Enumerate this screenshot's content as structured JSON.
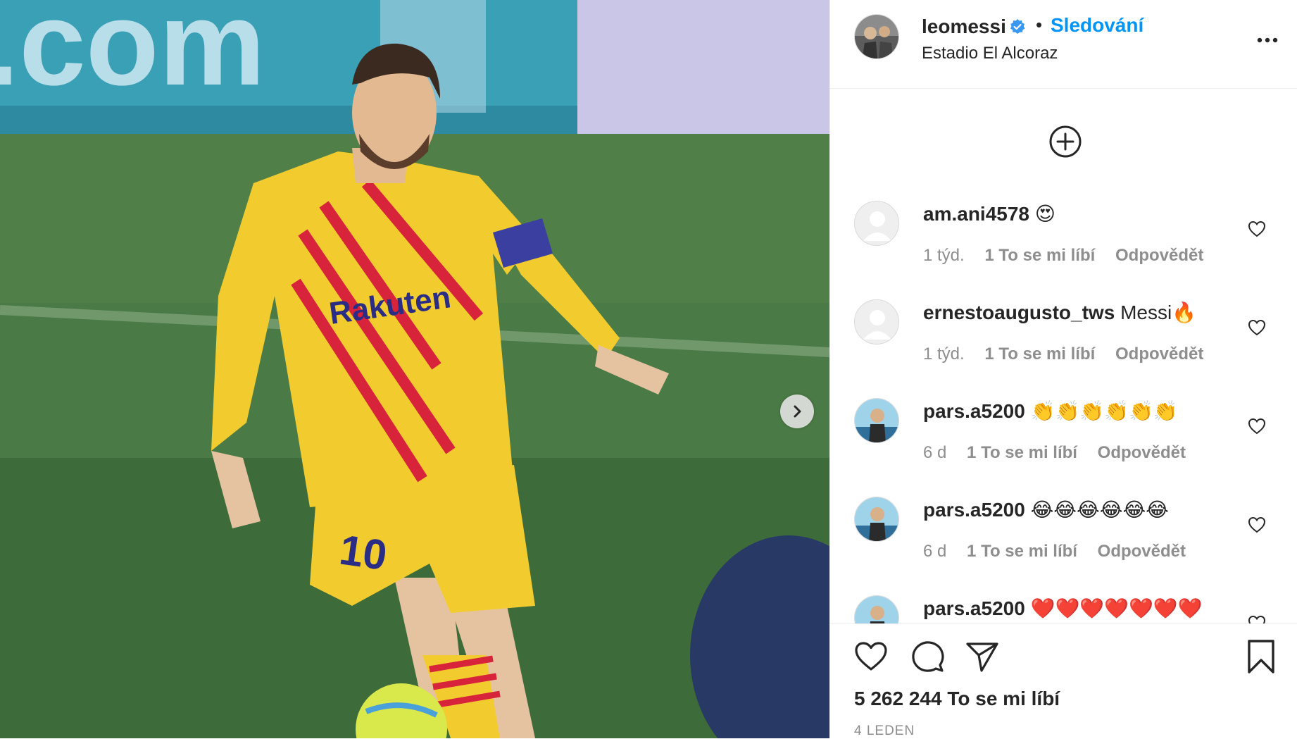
{
  "post": {
    "username": "leomessi",
    "follow_label": "Sledování",
    "dot": "•",
    "location": "Estadio El Alcoraz",
    "more_icon": "more-options-icon"
  },
  "media": {
    "banner_text": ".com",
    "sponsor": "Rakuten",
    "shirt_number": "10",
    "next_icon": "chevron-right-icon"
  },
  "comments": [
    {
      "user": "am.ani4578",
      "text": "😍",
      "time": "1 týd.",
      "likes": "1 To se mi líbí",
      "reply": "Odpovědět",
      "avatar": "default"
    },
    {
      "user": "ernestoaugusto_tws",
      "text": "Messi🔥",
      "time": "1 týd.",
      "likes": "1 To se mi líbí",
      "reply": "Odpovědět",
      "avatar": "default"
    },
    {
      "user": "pars.a5200",
      "text": "👏👏👏👏👏👏",
      "time": "6 d",
      "likes": "1 To se mi líbí",
      "reply": "Odpovědět",
      "avatar": "photo"
    },
    {
      "user": "pars.a5200",
      "text": "😂😂😂😂😂😂",
      "time": "6 d",
      "likes": "1 To se mi líbí",
      "reply": "Odpovědět",
      "avatar": "photo"
    },
    {
      "user": "pars.a5200",
      "text": "❤️❤️❤️❤️❤️❤️❤️",
      "time": "",
      "likes": "",
      "reply": "",
      "avatar": "photo"
    }
  ],
  "footer": {
    "likes_count": "5 262 244 To se mi líbí",
    "date": "4 LEDEN"
  },
  "colors": {
    "accent": "#0095f6",
    "text": "#262626",
    "muted": "#8e8e8e",
    "jersey": "#f2cc2e",
    "stripe": "#d8243a"
  }
}
